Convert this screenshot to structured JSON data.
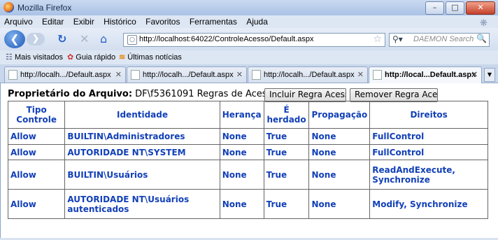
{
  "window": {
    "title": "Mozilla Firefox"
  },
  "menu": [
    "Arquivo",
    "Editar",
    "Exibir",
    "Histórico",
    "Favoritos",
    "Ferramentas",
    "Ajuda"
  ],
  "nav": {
    "url": "http://localhost:64022/ControleAcesso/Default.aspx",
    "search_placeholder": "DAEMON Search"
  },
  "bookmarks": [
    "Mais visitados",
    "Guia rápido",
    "Últimas notícias"
  ],
  "tabs": [
    {
      "label": "http://localh.../Default.aspx",
      "active": false
    },
    {
      "label": "http://localh.../Default.aspx",
      "active": false
    },
    {
      "label": "http://localh.../Default.aspx",
      "active": false
    },
    {
      "label": "http://local...Default.aspx",
      "active": true
    }
  ],
  "page": {
    "owner_label": "Proprietário do Arquivo:",
    "owner_value": "DF\\f5361091",
    "rules_label": "Regras de Acesso:",
    "add_button": "Incluir Regra Acesso",
    "remove_button": "Remover Regra Acesso"
  },
  "table": {
    "headers": [
      "Tipo Controle",
      "Identidade",
      "Herança",
      "É herdado",
      "Propagação",
      "Direitos"
    ],
    "rows": [
      [
        "Allow",
        "BUILTIN\\Administradores",
        "None",
        "True",
        "None",
        "FullControl"
      ],
      [
        "Allow",
        "AUTORIDADE NT\\SYSTEM",
        "None",
        "True",
        "None",
        "FullControl"
      ],
      [
        "Allow",
        "BUILTIN\\Usuários",
        "None",
        "True",
        "None",
        "ReadAndExecute, Synchronize"
      ],
      [
        "Allow",
        "AUTORIDADE NT\\Usuários autenticados",
        "None",
        "True",
        "None",
        "Modify, Synchronize"
      ]
    ]
  }
}
